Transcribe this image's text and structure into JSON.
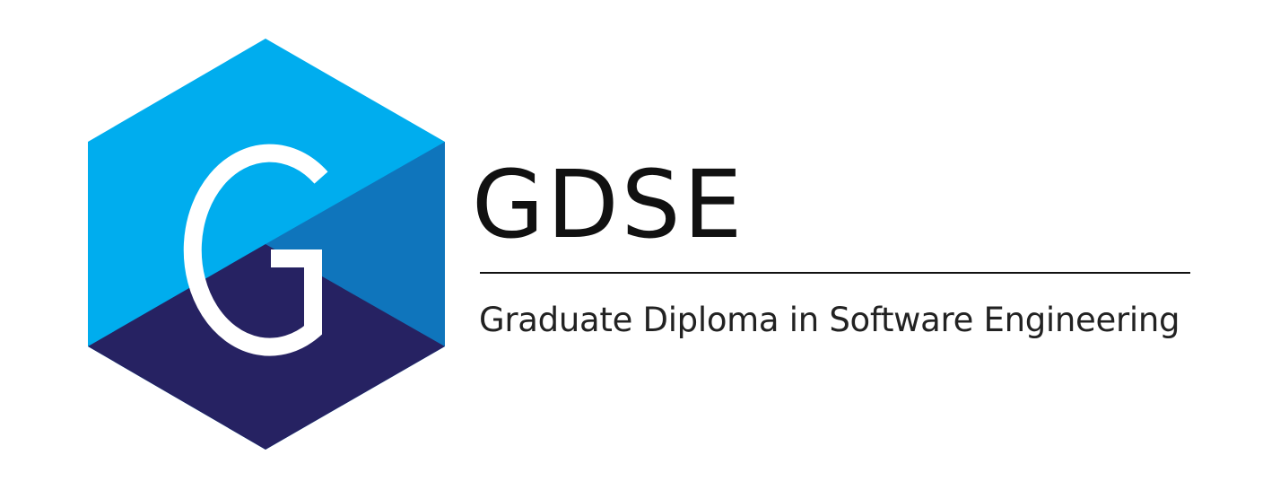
{
  "logo": {
    "icon": "hexagon-g-icon",
    "letter": "G",
    "colors": {
      "light_blue": "#00ADEE",
      "mid_blue": "#0F75BC",
      "dark_navy": "#262262",
      "letter": "#FFFFFF"
    }
  },
  "brand": {
    "acronym": "GDSE",
    "full_name": "Graduate Diploma in Software Engineering",
    "text_color": "#111111"
  }
}
